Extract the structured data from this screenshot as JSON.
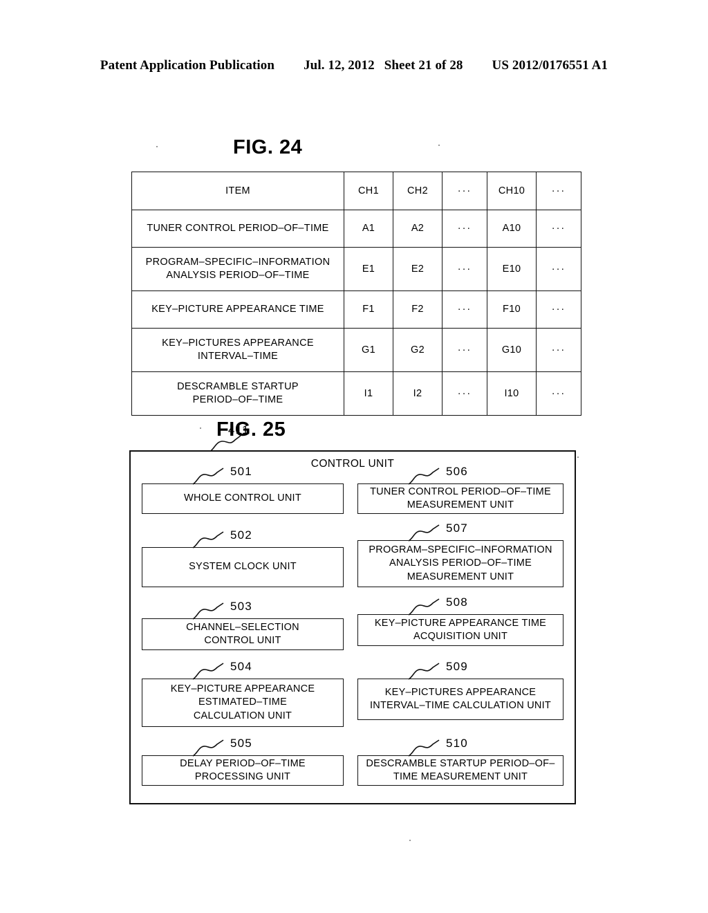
{
  "header": {
    "publication": "Patent Application Publication",
    "date": "Jul. 12, 2012",
    "sheet": "Sheet 21 of 28",
    "number": "US 2012/0176551 A1"
  },
  "fig24": {
    "title": "FIG. 24",
    "columns": [
      "ITEM",
      "CH1",
      "CH2",
      "···",
      "CH10",
      "···"
    ],
    "rows": [
      {
        "item": "TUNER CONTROL PERIOD–OF–TIME",
        "item_lines": [
          "TUNER CONTROL PERIOD–OF–TIME"
        ],
        "values": [
          "A1",
          "A2",
          "···",
          "A10",
          "···"
        ]
      },
      {
        "item": "PROGRAM–SPECIFIC–INFORMATION ANALYSIS PERIOD–OF–TIME",
        "item_lines": [
          "PROGRAM–SPECIFIC–INFORMATION",
          "ANALYSIS PERIOD–OF–TIME"
        ],
        "values": [
          "E1",
          "E2",
          "···",
          "E10",
          "···"
        ]
      },
      {
        "item": "KEY–PICTURE APPEARANCE TIME",
        "item_lines": [
          "KEY–PICTURE APPEARANCE TIME"
        ],
        "values": [
          "F1",
          "F2",
          "···",
          "F10",
          "···"
        ]
      },
      {
        "item": "KEY–PICTURES APPEARANCE INTERVAL–TIME",
        "item_lines": [
          "KEY–PICTURES APPEARANCE",
          "INTERVAL–TIME"
        ],
        "values": [
          "G1",
          "G2",
          "···",
          "G10",
          "···"
        ]
      },
      {
        "item": "DESCRAMBLE STARTUP PERIOD–OF–TIME",
        "item_lines": [
          "DESCRAMBLE STARTUP",
          "PERIOD–OF–TIME"
        ],
        "values": [
          "I1",
          "I2",
          "···",
          "I10",
          "···"
        ]
      }
    ]
  },
  "fig25": {
    "title": "FIG. 25",
    "outer_ref": "411",
    "outer_label": "CONTROL UNIT",
    "left_column": [
      {
        "ref": "501",
        "label": "WHOLE CONTROL UNIT",
        "lines": [
          "WHOLE CONTROL UNIT"
        ]
      },
      {
        "ref": "502",
        "label": "SYSTEM CLOCK UNIT",
        "lines": [
          "SYSTEM CLOCK UNIT"
        ]
      },
      {
        "ref": "503",
        "label": "CHANNEL–SELECTION CONTROL UNIT",
        "lines": [
          "CHANNEL–SELECTION",
          "CONTROL UNIT"
        ]
      },
      {
        "ref": "504",
        "label": "KEY–PICTURE APPEARANCE ESTIMATED–TIME CALCULATION UNIT",
        "lines": [
          "KEY–PICTURE APPEARANCE",
          "ESTIMATED–TIME",
          "CALCULATION UNIT"
        ]
      },
      {
        "ref": "505",
        "label": "DELAY PERIOD–OF–TIME PROCESSING UNIT",
        "lines": [
          "DELAY PERIOD–OF–TIME",
          "PROCESSING UNIT"
        ]
      }
    ],
    "right_column": [
      {
        "ref": "506",
        "label": "TUNER CONTROL PERIOD–OF–TIME MEASUREMENT UNIT",
        "lines": [
          "TUNER CONTROL PERIOD–OF–TIME",
          "MEASUREMENT UNIT"
        ]
      },
      {
        "ref": "507",
        "label": "PROGRAM–SPECIFIC–INFORMATION ANALYSIS PERIOD–OF–TIME MEASUREMENT UNIT",
        "lines": [
          "PROGRAM–SPECIFIC–INFORMATION",
          "ANALYSIS PERIOD–OF–TIME",
          "MEASUREMENT UNIT"
        ]
      },
      {
        "ref": "508",
        "label": "KEY–PICTURE APPEARANCE TIME ACQUISITION UNIT",
        "lines": [
          "KEY–PICTURE APPEARANCE TIME",
          "ACQUISITION UNIT"
        ]
      },
      {
        "ref": "509",
        "label": "KEY–PICTURES APPEARANCE INTERVAL–TIME CALCULATION UNIT",
        "lines": [
          "KEY–PICTURES APPEARANCE",
          "INTERVAL–TIME CALCULATION UNIT"
        ]
      },
      {
        "ref": "510",
        "label": "DESCRAMBLE STARTUP PERIOD–OF– TIME MEASUREMENT UNIT",
        "lines": [
          "DESCRAMBLE STARTUP PERIOD–OF–",
          "TIME MEASUREMENT UNIT"
        ]
      }
    ]
  }
}
